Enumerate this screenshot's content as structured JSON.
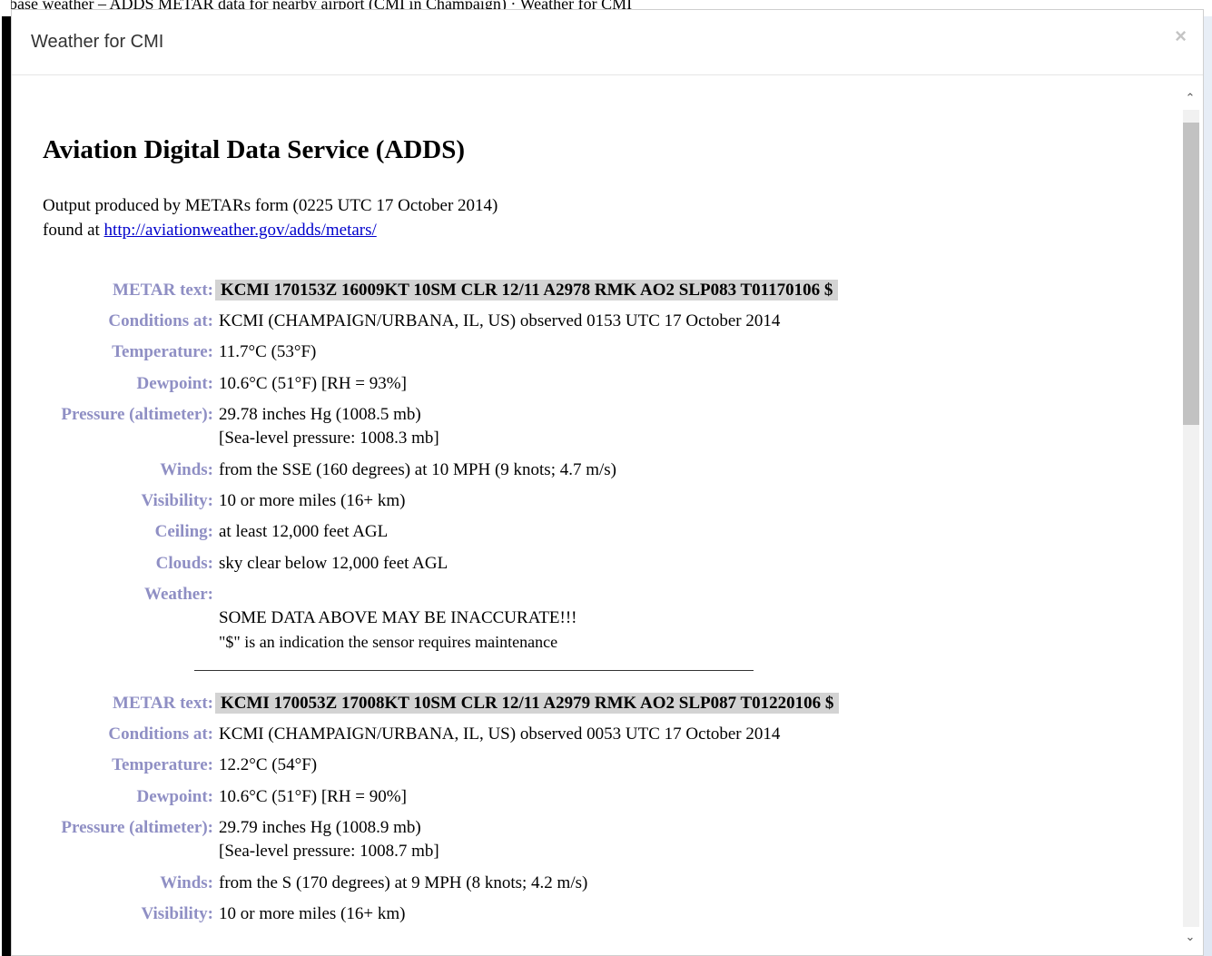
{
  "top_fragment": "base weather – ADDS METAR data for nearby airport (CMI in Champaign) · Weather for CMI",
  "modal": {
    "title": "Weather for CMI",
    "close_label": "×"
  },
  "adds": {
    "title": "Aviation Digital Data Service (ADDS)",
    "intro_line1": "Output produced by METARs form (0225 UTC 17 October 2014)",
    "intro_line2_prefix": "found at ",
    "intro_link": "http://aviationweather.gov/adds/metars/"
  },
  "labels": {
    "metar": "METAR text:",
    "conditions": "Conditions at:",
    "temperature": "Temperature:",
    "dewpoint": "Dewpoint:",
    "pressure": "Pressure (altimeter):",
    "winds": "Winds:",
    "visibility": "Visibility:",
    "ceiling": "Ceiling:",
    "clouds": "Clouds:",
    "weather": "Weather:"
  },
  "reports": [
    {
      "metar": "KCMI 170153Z 16009KT 10SM CLR 12/11 A2978 RMK AO2 SLP083 T01170106 $",
      "conditions": "KCMI (CHAMPAIGN/URBANA, IL, US) observed 0153 UTC 17 October 2014",
      "temperature": "11.7°C (53°F)",
      "dewpoint": "10.6°C (51°F) [RH = 93%]",
      "pressure": "29.78 inches Hg (1008.5 mb)",
      "sea_level": "[Sea-level pressure: 1008.3 mb]",
      "winds": "from the SSE (160 degrees) at 10 MPH (9 knots; 4.7 m/s)",
      "visibility": "10 or more miles (16+ km)",
      "ceiling": "at least 12,000 feet AGL",
      "clouds": "sky clear below 12,000 feet AGL",
      "weather": "",
      "warning": "SOME DATA ABOVE MAY BE INACCURATE!!!",
      "warning_note": "\"$\" is an indication the sensor requires maintenance"
    },
    {
      "metar": "KCMI 170053Z 17008KT 10SM CLR 12/11 A2979 RMK AO2 SLP087 T01220106 $",
      "conditions": "KCMI (CHAMPAIGN/URBANA, IL, US) observed 0053 UTC 17 October 2014",
      "temperature": "12.2°C (54°F)",
      "dewpoint": "10.6°C (51°F) [RH = 90%]",
      "pressure": "29.79 inches Hg (1008.9 mb)",
      "sea_level": "[Sea-level pressure: 1008.7 mb]",
      "winds": "from the S (170 degrees) at 9 MPH (8 knots; 4.2 m/s)",
      "visibility": "10 or more miles (16+ km)"
    }
  ],
  "icons": {
    "scroll_up": "chevron-up-icon",
    "scroll_down": "chevron-down-icon",
    "close": "close-icon"
  }
}
